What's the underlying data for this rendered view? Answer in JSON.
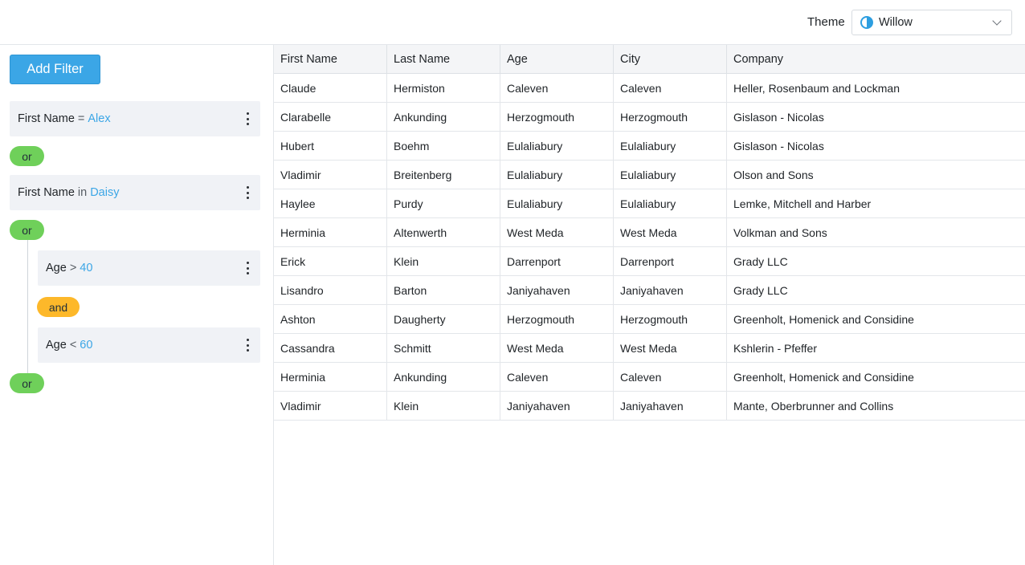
{
  "topbar": {
    "theme_label": "Theme",
    "theme_value": "Willow"
  },
  "filters": {
    "add_button": "Add Filter",
    "items": [
      {
        "field": "First Name",
        "op": "=",
        "value": "Alex"
      },
      {
        "joiner": "or"
      },
      {
        "field": "First Name",
        "op": "in",
        "value": "Daisy"
      },
      {
        "joiner": "or"
      },
      {
        "field": "Age",
        "op": ">",
        "value": "40"
      },
      {
        "joiner": "and"
      },
      {
        "field": "Age",
        "op": "<",
        "value": "60"
      },
      {
        "joiner": "or"
      }
    ]
  },
  "grid": {
    "columns": [
      "First Name",
      "Last Name",
      "Age",
      "City",
      "Company"
    ],
    "rows": [
      [
        "Claude",
        "Hermiston",
        "Caleven",
        "Caleven",
        "Heller, Rosenbaum and Lockman"
      ],
      [
        "Clarabelle",
        "Ankunding",
        "Herzogmouth",
        "Herzogmouth",
        "Gislason - Nicolas"
      ],
      [
        "Hubert",
        "Boehm",
        "Eulaliabury",
        "Eulaliabury",
        "Gislason - Nicolas"
      ],
      [
        "Vladimir",
        "Breitenberg",
        "Eulaliabury",
        "Eulaliabury",
        "Olson and Sons"
      ],
      [
        "Haylee",
        "Purdy",
        "Eulaliabury",
        "Eulaliabury",
        "Lemke, Mitchell and Harber"
      ],
      [
        "Herminia",
        "Altenwerth",
        "West Meda",
        "West Meda",
        "Volkman and Sons"
      ],
      [
        "Erick",
        "Klein",
        "Darrenport",
        "Darrenport",
        "Grady LLC"
      ],
      [
        "Lisandro",
        "Barton",
        "Janiyahaven",
        "Janiyahaven",
        "Grady LLC"
      ],
      [
        "Ashton",
        "Daugherty",
        "Herzogmouth",
        "Herzogmouth",
        "Greenholt, Homenick and Considine"
      ],
      [
        "Cassandra",
        "Schmitt",
        "West Meda",
        "West Meda",
        "Kshlerin - Pfeffer"
      ],
      [
        "Herminia",
        "Ankunding",
        "Caleven",
        "Caleven",
        "Greenholt, Homenick and Considine"
      ],
      [
        "Vladimir",
        "Klein",
        "Janiyahaven",
        "Janiyahaven",
        "Mante, Oberbrunner and Collins"
      ]
    ]
  },
  "colors": {
    "accent": "#3ba6e6",
    "or_pill": "#6fd05a",
    "and_pill": "#fdb82a"
  }
}
